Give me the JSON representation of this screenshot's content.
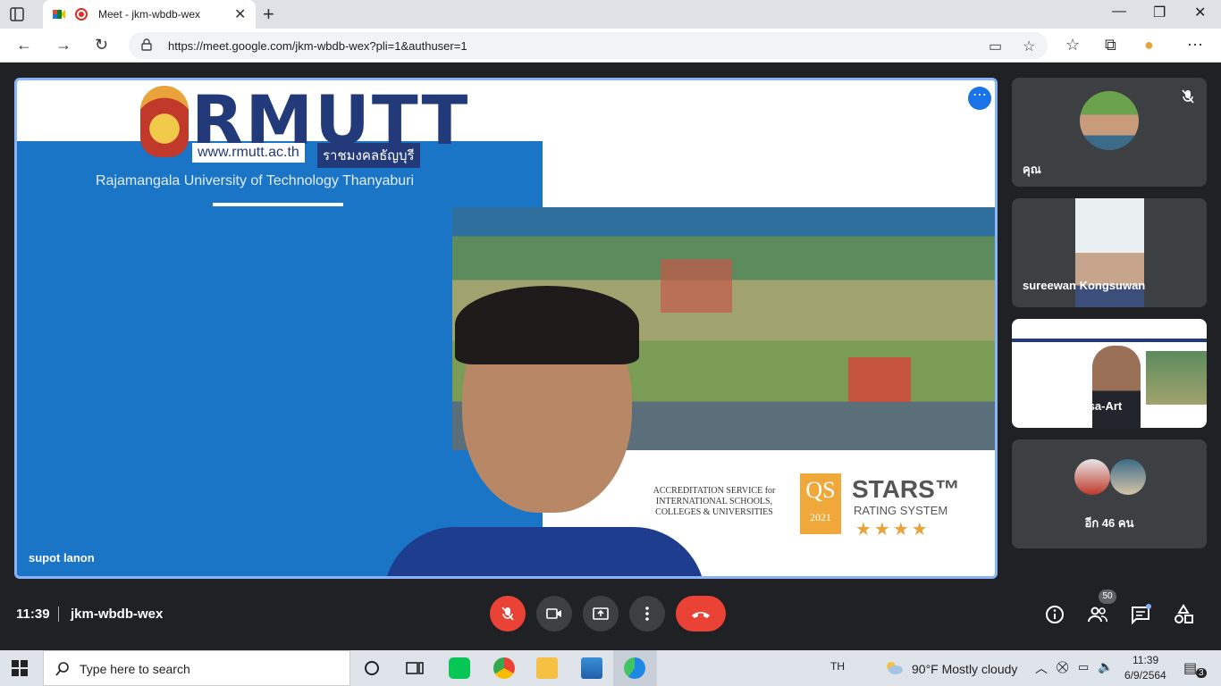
{
  "browser": {
    "tab_title": "Meet - jkm-wbdb-wex",
    "url": "https://meet.google.com/jkm-wbdb-wex?pli=1&authuser=1"
  },
  "slide": {
    "logo": "RMUTT",
    "site": "www.rmutt.ac.th",
    "site_thai": "ราชมงคลธัญบุรี",
    "university": "Rajamangala University of Technology Thanyaburi",
    "accreditation": "ACCREDITATION SERVICE for INTERNATIONAL SCHOOLS, COLLEGES & UNIVERSITIES",
    "qs": "QS",
    "qs_year": "2021",
    "stars_title": "STARS™",
    "stars_sub": "RATING SYSTEM",
    "stars_rating": "★★★★"
  },
  "presenter": {
    "name": "supot lanon"
  },
  "participants": [
    {
      "name": "คุณ",
      "muted": true
    },
    {
      "name": "sureewan Kongsuwan"
    },
    {
      "name": "Sommai Pivsa-Art"
    },
    {
      "name": "อีก 46 คน"
    }
  ],
  "bottom_bar": {
    "time": "11:39",
    "meeting_code": "jkm-wbdb-wex",
    "people_count": "50"
  },
  "taskbar": {
    "search_placeholder": "Type here to search",
    "language": "TH",
    "weather": "90°F  Mostly cloudy",
    "clock_time": "11:39",
    "clock_date": "6/9/2564",
    "notifications": "3"
  },
  "colors": {
    "accent": "#8ab4f8",
    "end_call": "#ea4335",
    "meet_bg": "#202124",
    "tile_bg": "#3c4043"
  }
}
